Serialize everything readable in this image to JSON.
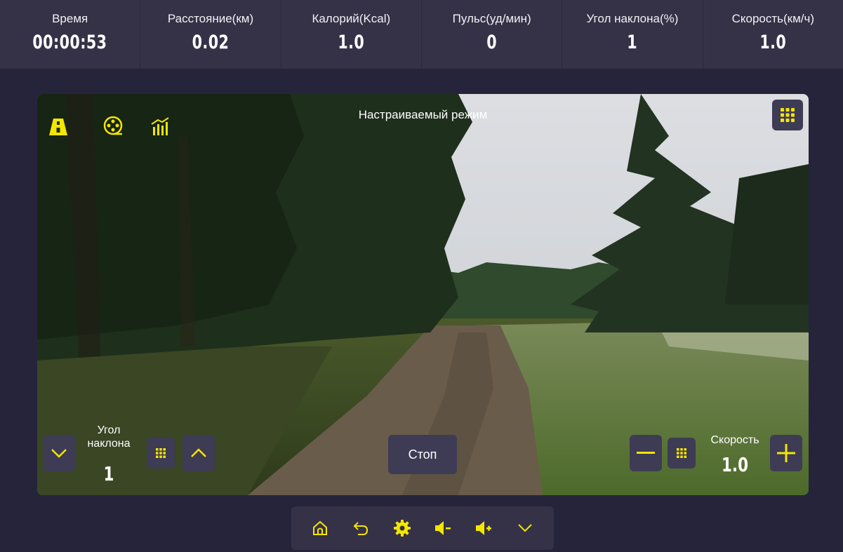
{
  "stats": [
    {
      "label": "Время",
      "value": "00:00:53"
    },
    {
      "label": "Расстояние(км)",
      "value": "0.02"
    },
    {
      "label": "Калорий(Kcal)",
      "value": "1.0"
    },
    {
      "label": "Пульс(уд/мин)",
      "value": "0"
    },
    {
      "label": "Угол наклона(%)",
      "value": "1"
    },
    {
      "label": "Скорость(км/ч)",
      "value": "1.0"
    }
  ],
  "video": {
    "mode_title": "Настраиваемый режим",
    "top_icons": [
      "road-icon",
      "film-reel-icon",
      "stats-chart-icon"
    ],
    "grid_button_icon": "grid-icon"
  },
  "incline": {
    "label_line1": "Угол",
    "label_line2": "наклона",
    "value": "1"
  },
  "speed": {
    "label": "Скорость",
    "value": "1.0"
  },
  "stop_label": "Стоп",
  "bottom_bar": [
    "home-icon",
    "back-icon",
    "settings-icon",
    "volume-down-icon",
    "volume-up-icon",
    "chevron-down-icon"
  ],
  "colors": {
    "accent": "#f5e600",
    "panel": "#353248",
    "background": "#26243a",
    "button": "#3e3b55"
  }
}
